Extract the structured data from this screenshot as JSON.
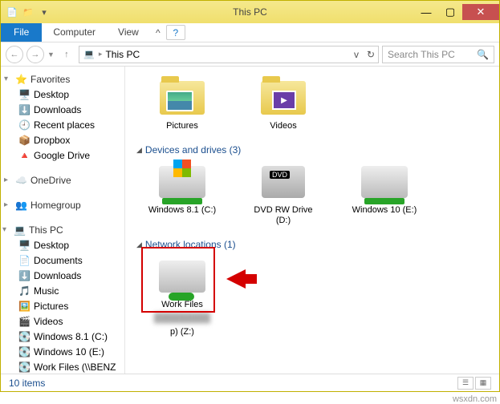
{
  "window": {
    "title": "This PC"
  },
  "ribbon": {
    "file": "File",
    "computer": "Computer",
    "view": "View"
  },
  "nav": {
    "address": "This PC",
    "searchPlaceholder": "Search This PC"
  },
  "tree": {
    "favorites": {
      "label": "Favorites",
      "items": [
        "Desktop",
        "Downloads",
        "Recent places",
        "Dropbox",
        "Google Drive"
      ]
    },
    "onedrive": "OneDrive",
    "homegroup": "Homegroup",
    "thispc": {
      "label": "This PC",
      "items": [
        "Desktop",
        "Documents",
        "Downloads",
        "Music",
        "Pictures",
        "Videos",
        "Windows 8.1 (C:)",
        "Windows 10 (E:)",
        "Work Files (\\\\BENZ"
      ]
    }
  },
  "content": {
    "topItems": [
      "Pictures",
      "Videos"
    ],
    "devicesHead": "Devices and drives (3)",
    "drives": [
      {
        "label": "Windows 8.1 (C:)"
      },
      {
        "label": "DVD RW Drive (D:)"
      },
      {
        "label": "Windows 10 (E:)"
      }
    ],
    "netHead": "Network locations (1)",
    "netItems": [
      {
        "label": "Work Files",
        "sub": "p) (Z:)"
      }
    ]
  },
  "status": {
    "count": "10 items"
  },
  "watermark": "wsxdn.com"
}
